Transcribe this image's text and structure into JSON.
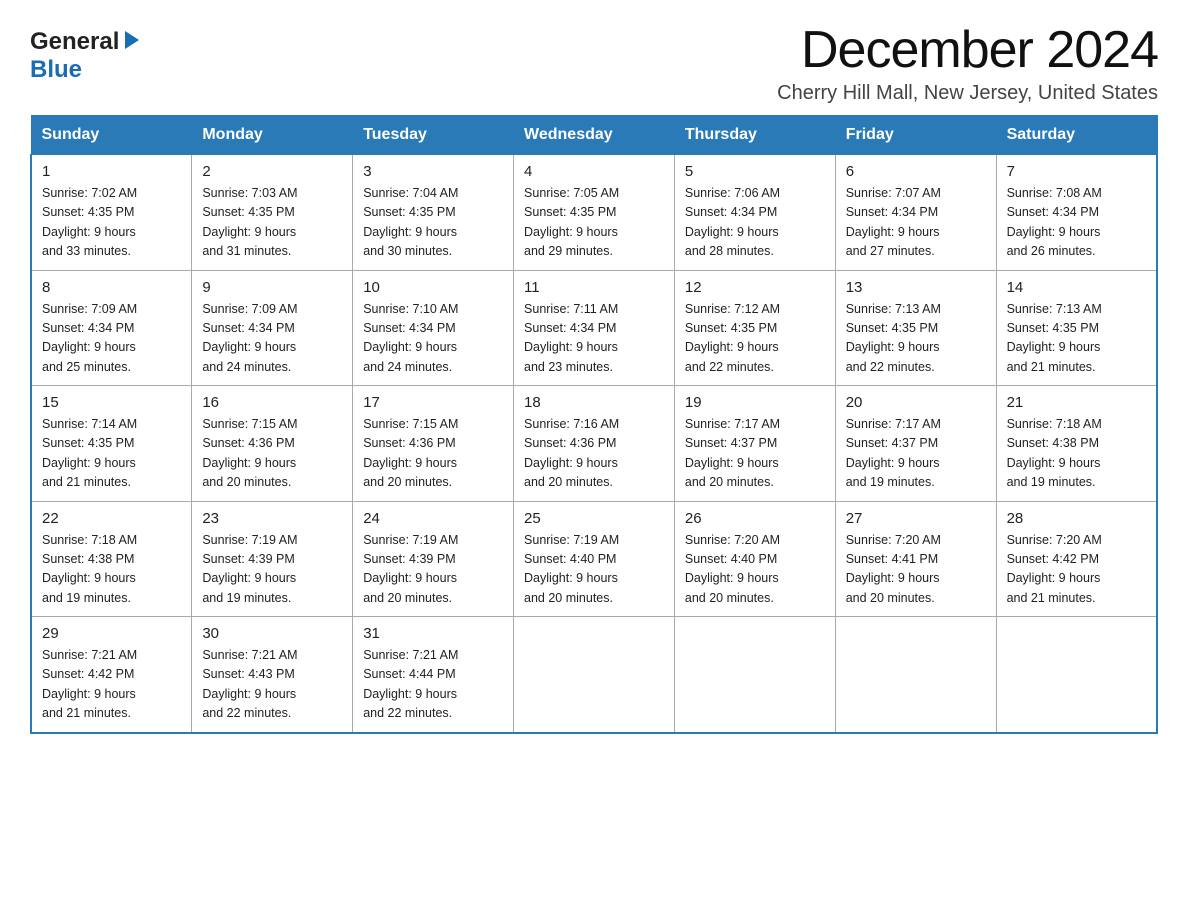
{
  "header": {
    "month_title": "December 2024",
    "location": "Cherry Hill Mall, New Jersey, United States",
    "logo_general": "General",
    "logo_blue": "Blue"
  },
  "weekdays": [
    "Sunday",
    "Monday",
    "Tuesday",
    "Wednesday",
    "Thursday",
    "Friday",
    "Saturday"
  ],
  "weeks": [
    [
      {
        "day": "1",
        "sunrise": "7:02 AM",
        "sunset": "4:35 PM",
        "daylight": "9 hours and 33 minutes."
      },
      {
        "day": "2",
        "sunrise": "7:03 AM",
        "sunset": "4:35 PM",
        "daylight": "9 hours and 31 minutes."
      },
      {
        "day": "3",
        "sunrise": "7:04 AM",
        "sunset": "4:35 PM",
        "daylight": "9 hours and 30 minutes."
      },
      {
        "day": "4",
        "sunrise": "7:05 AM",
        "sunset": "4:35 PM",
        "daylight": "9 hours and 29 minutes."
      },
      {
        "day": "5",
        "sunrise": "7:06 AM",
        "sunset": "4:34 PM",
        "daylight": "9 hours and 28 minutes."
      },
      {
        "day": "6",
        "sunrise": "7:07 AM",
        "sunset": "4:34 PM",
        "daylight": "9 hours and 27 minutes."
      },
      {
        "day": "7",
        "sunrise": "7:08 AM",
        "sunset": "4:34 PM",
        "daylight": "9 hours and 26 minutes."
      }
    ],
    [
      {
        "day": "8",
        "sunrise": "7:09 AM",
        "sunset": "4:34 PM",
        "daylight": "9 hours and 25 minutes."
      },
      {
        "day": "9",
        "sunrise": "7:09 AM",
        "sunset": "4:34 PM",
        "daylight": "9 hours and 24 minutes."
      },
      {
        "day": "10",
        "sunrise": "7:10 AM",
        "sunset": "4:34 PM",
        "daylight": "9 hours and 24 minutes."
      },
      {
        "day": "11",
        "sunrise": "7:11 AM",
        "sunset": "4:34 PM",
        "daylight": "9 hours and 23 minutes."
      },
      {
        "day": "12",
        "sunrise": "7:12 AM",
        "sunset": "4:35 PM",
        "daylight": "9 hours and 22 minutes."
      },
      {
        "day": "13",
        "sunrise": "7:13 AM",
        "sunset": "4:35 PM",
        "daylight": "9 hours and 22 minutes."
      },
      {
        "day": "14",
        "sunrise": "7:13 AM",
        "sunset": "4:35 PM",
        "daylight": "9 hours and 21 minutes."
      }
    ],
    [
      {
        "day": "15",
        "sunrise": "7:14 AM",
        "sunset": "4:35 PM",
        "daylight": "9 hours and 21 minutes."
      },
      {
        "day": "16",
        "sunrise": "7:15 AM",
        "sunset": "4:36 PM",
        "daylight": "9 hours and 20 minutes."
      },
      {
        "day": "17",
        "sunrise": "7:15 AM",
        "sunset": "4:36 PM",
        "daylight": "9 hours and 20 minutes."
      },
      {
        "day": "18",
        "sunrise": "7:16 AM",
        "sunset": "4:36 PM",
        "daylight": "9 hours and 20 minutes."
      },
      {
        "day": "19",
        "sunrise": "7:17 AM",
        "sunset": "4:37 PM",
        "daylight": "9 hours and 20 minutes."
      },
      {
        "day": "20",
        "sunrise": "7:17 AM",
        "sunset": "4:37 PM",
        "daylight": "9 hours and 19 minutes."
      },
      {
        "day": "21",
        "sunrise": "7:18 AM",
        "sunset": "4:38 PM",
        "daylight": "9 hours and 19 minutes."
      }
    ],
    [
      {
        "day": "22",
        "sunrise": "7:18 AM",
        "sunset": "4:38 PM",
        "daylight": "9 hours and 19 minutes."
      },
      {
        "day": "23",
        "sunrise": "7:19 AM",
        "sunset": "4:39 PM",
        "daylight": "9 hours and 19 minutes."
      },
      {
        "day": "24",
        "sunrise": "7:19 AM",
        "sunset": "4:39 PM",
        "daylight": "9 hours and 20 minutes."
      },
      {
        "day": "25",
        "sunrise": "7:19 AM",
        "sunset": "4:40 PM",
        "daylight": "9 hours and 20 minutes."
      },
      {
        "day": "26",
        "sunrise": "7:20 AM",
        "sunset": "4:40 PM",
        "daylight": "9 hours and 20 minutes."
      },
      {
        "day": "27",
        "sunrise": "7:20 AM",
        "sunset": "4:41 PM",
        "daylight": "9 hours and 20 minutes."
      },
      {
        "day": "28",
        "sunrise": "7:20 AM",
        "sunset": "4:42 PM",
        "daylight": "9 hours and 21 minutes."
      }
    ],
    [
      {
        "day": "29",
        "sunrise": "7:21 AM",
        "sunset": "4:42 PM",
        "daylight": "9 hours and 21 minutes."
      },
      {
        "day": "30",
        "sunrise": "7:21 AM",
        "sunset": "4:43 PM",
        "daylight": "9 hours and 22 minutes."
      },
      {
        "day": "31",
        "sunrise": "7:21 AM",
        "sunset": "4:44 PM",
        "daylight": "9 hours and 22 minutes."
      },
      null,
      null,
      null,
      null
    ]
  ]
}
